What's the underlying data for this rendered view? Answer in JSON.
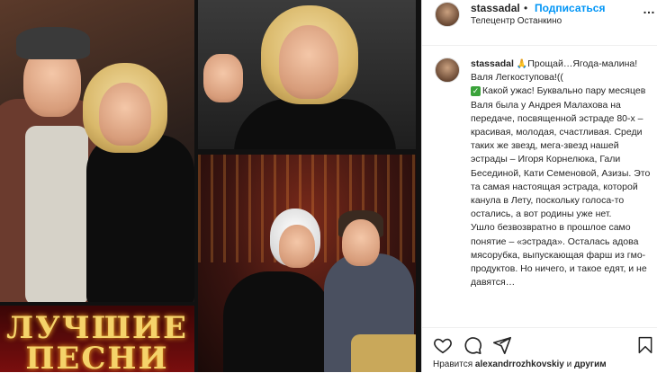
{
  "post_header": {
    "username": "stassadal",
    "separator": "•",
    "follow_label": "Подписаться",
    "location": "Телецентр Останкино",
    "more_label": "…"
  },
  "caption": {
    "username": "stassadal",
    "line_intro": "Прощай…Ягода-малина! Валя Легкоступова!((",
    "body": "Какой ужас! Буквально пару месяцев Валя была у Андрея Малахова на передаче, посвященной эстраде 80-х – красивая, молодая, счастливая. Среди таких же звезд, мега-звезд нашей эстрады – Игоря Корнелюка, Гали Бесединой, Кати Семеновой, Азизы. Это та самая настоящая эстрада, которой канула в Лету, поскольку голоса-то остались, а вот родины уже нет.",
    "body2": "Ушло безвозвратно в прошлое само понятие – «эстрада». Осталась адова мясорубка, выпускающая фарш из гмо-продуктов. Но ничего, и такое едят, и не давятся…"
  },
  "media": {
    "promo_text": "ЛУЧШИЕ ПЕСНИ"
  },
  "likes": {
    "prefix": "Нравится",
    "user": "alexandrrozhkovskiy",
    "conj": "и",
    "others": "другим"
  },
  "colors": {
    "follow": "#0095f6",
    "text": "#262626",
    "check": "#3aa33a"
  },
  "icons": [
    "heart-icon",
    "comment-icon",
    "share-icon",
    "bookmark-icon"
  ]
}
